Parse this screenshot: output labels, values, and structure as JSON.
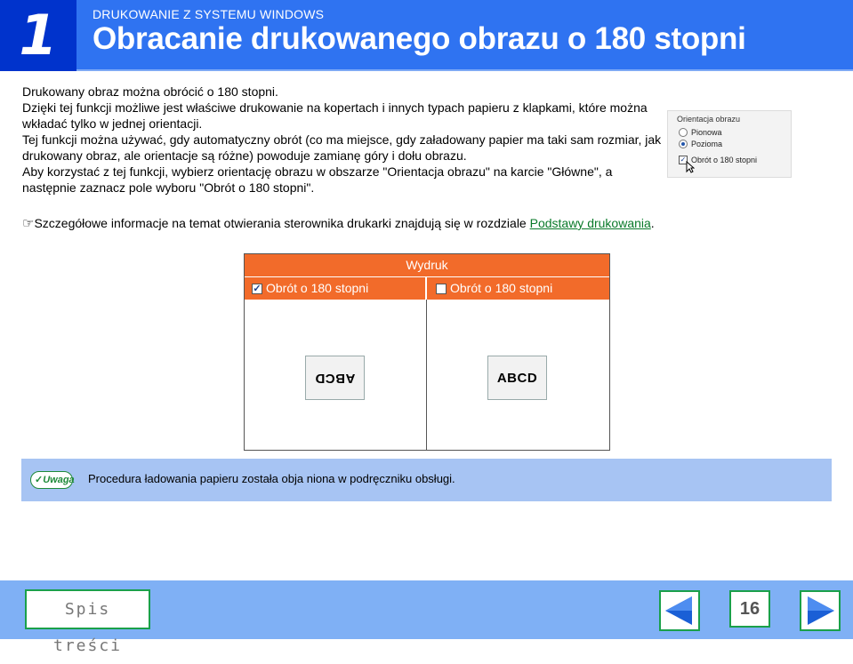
{
  "header": {
    "chapter_number": "1",
    "section": "DRUKOWANIE Z SYSTEMU WINDOWS",
    "title": "Obracanie drukowanego obrazu o 180 stopni"
  },
  "body": {
    "paragraphs": [
      "Drukowany obraz można obrócić o 180 stopni.",
      "Dzięki tej funkcji możliwe jest właściwe drukowanie na kopertach i innych typach papieru z klapkami, które można wkładać tylko w jednej orientacji.",
      "Tej funkcji można używać, gdy automatyczny obrót (co ma miejsce, gdy załadowany papier ma taki sam rozmiar, jak drukowany obraz, ale orientacje są różne) powoduje zamianę góry i dołu obrazu.",
      "Aby korzystać z tej funkcji, wybierz orientację obrazu w obszarze \"Orientacja obrazu\" na karcie \"Główne\", a następnie zaznacz pole wyboru \"Obrót o 180 stopni\"."
    ],
    "reference_prefix": "Szczegółowe informacje na temat otwierania sterownika drukarki znajdują się w rozdziale ",
    "reference_link": "Podstawy drukowania",
    "reference_suffix": "."
  },
  "settings_panel": {
    "group_label": "Orientacja obrazu",
    "option_portrait": "Pionowa",
    "option_landscape": "Pozioma",
    "rotate_checkbox": "Obrót o 180 stopni"
  },
  "diagram": {
    "header": "Wydruk",
    "col_checked": "Obrót o 180 stopni",
    "col_unchecked": "Obrót o 180 stopni",
    "sample_rotated": "ABCD",
    "sample_normal": "ABCD"
  },
  "note": {
    "badge": "Uwaga",
    "text": "Procedura ładowania papieru została obja niona w podręczniku obsługi."
  },
  "footer": {
    "toc": "Spis treści",
    "page": "16"
  },
  "colors": {
    "chapter_blue": "#0033cc",
    "header_blue": "#2f73f1",
    "diagram_orange": "#f26b2a",
    "note_blue": "#a7c4f3",
    "footer_blue": "#7fb0f5",
    "nav_green": "#1aa04a"
  },
  "icons": {
    "reference": "pointing-hand-icon",
    "prev": "arrow-left-icon",
    "next": "arrow-right-icon",
    "note": "check-icon"
  }
}
